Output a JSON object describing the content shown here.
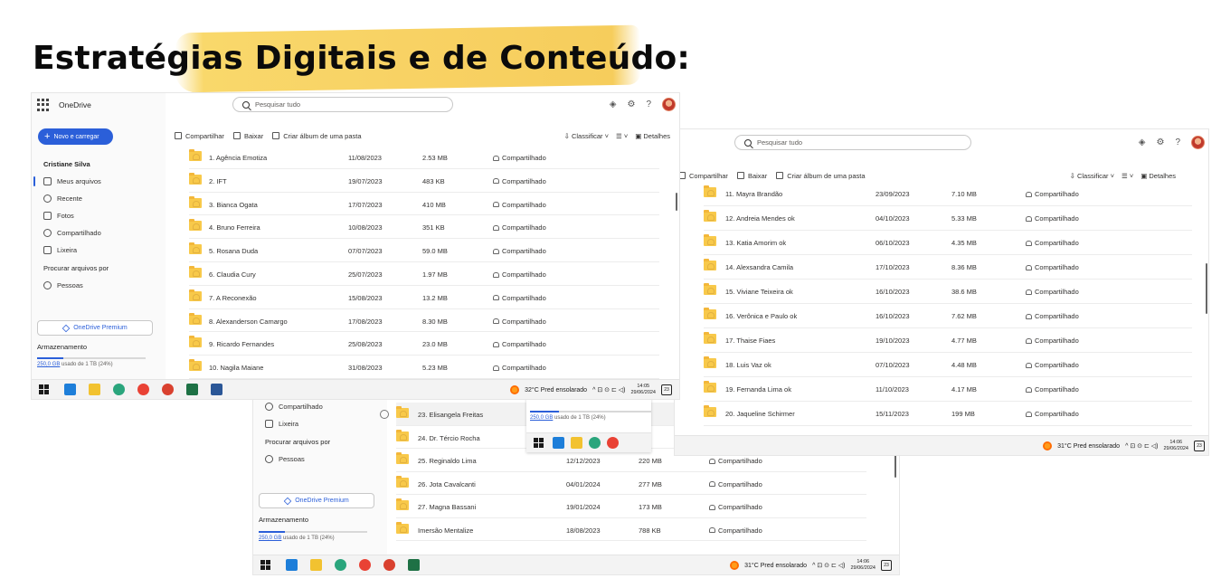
{
  "title": "Estratégias Digitais e de Conteúdo:",
  "app": {
    "brand": "OneDrive",
    "search_placeholder": "Pesquisar tudo",
    "new_button": "Novo e carregar",
    "user": "Cristiane Silva",
    "nav_items": [
      "Meus arquivos",
      "Recente",
      "Fotos",
      "Compartilhado",
      "Lixeira"
    ],
    "nav_header": "Procurar arquivos por",
    "nav_people": "Pessoas",
    "premium": "OneDrive Premium",
    "storage_title": "Armazenamento",
    "storage_used_link": "250,0 GB",
    "storage_used_rest": "usado de 1 TB (24%)",
    "storage_fraction": 0.24,
    "cmd_share": "Compartilhar",
    "cmd_download": "Baixar",
    "cmd_album": "Criar álbum de uma pasta",
    "cmd_sort": "Classificar",
    "cmd_details": "Detalhes",
    "shared_label": "Compartilhado"
  },
  "window1": {
    "rows": [
      {
        "name": "1. Agência Emotiza",
        "date": "11/08/2023",
        "size": "2.53 MB"
      },
      {
        "name": "2. IFT",
        "date": "19/07/2023",
        "size": "483 KB"
      },
      {
        "name": "3. Bianca Ogata",
        "date": "17/07/2023",
        "size": "410 MB"
      },
      {
        "name": "4. Bruno Ferreira",
        "date": "10/08/2023",
        "size": "351 KB"
      },
      {
        "name": "5. Rosana Duda",
        "date": "07/07/2023",
        "size": "59.0 MB"
      },
      {
        "name": "6. Claudia Cury",
        "date": "25/07/2023",
        "size": "1.97 MB"
      },
      {
        "name": "7. A Reconexão",
        "date": "15/08/2023",
        "size": "13.2 MB"
      },
      {
        "name": "8. Alexanderson Camargo",
        "date": "17/08/2023",
        "size": "8.30 MB"
      },
      {
        "name": "9. Ricardo Fernandes",
        "date": "25/08/2023",
        "size": "23.0 MB"
      },
      {
        "name": "10. Nagila Maiane",
        "date": "31/08/2023",
        "size": "5.23 MB"
      }
    ],
    "weather": "32°C  Pred ensolarado",
    "time": "14:05",
    "date": "29/06/2024",
    "notif": "23"
  },
  "window2": {
    "rows": [
      {
        "name": "11. Mayra Brandão",
        "date": "23/09/2023",
        "size": "7.10 MB"
      },
      {
        "name": "12. Andreia Mendes ok",
        "date": "04/10/2023",
        "size": "5.33 MB"
      },
      {
        "name": "13. Katia Amorim ok",
        "date": "06/10/2023",
        "size": "4.35 MB"
      },
      {
        "name": "14. Alexsandra Camila",
        "date": "17/10/2023",
        "size": "8.36 MB"
      },
      {
        "name": "15. Viviane Teixeira ok",
        "date": "16/10/2023",
        "size": "38.6 MB"
      },
      {
        "name": "16. Verônica e Paulo ok",
        "date": "16/10/2023",
        "size": "7.62 MB"
      },
      {
        "name": "17. Thaise Fiaes",
        "date": "19/10/2023",
        "size": "4.77 MB"
      },
      {
        "name": "18. Luis Vaz ok",
        "date": "07/10/2023",
        "size": "4.48 MB"
      },
      {
        "name": "19. Fernanda Lima ok",
        "date": "11/10/2023",
        "size": "4.17 MB"
      },
      {
        "name": "20. Jaqueline Schirmer",
        "date": "15/11/2023",
        "size": "199 MB"
      }
    ],
    "weather": "31°C  Pred ensolarado",
    "time": "14:06",
    "date": "29/06/2024",
    "notif": "23"
  },
  "window3": {
    "rows": [
      {
        "name": "23. Elisangela Freitas",
        "date": "",
        "size": ""
      },
      {
        "name": "24. Dr. Tércio Rocha",
        "date": "",
        "size": ""
      },
      {
        "name": "25. Reginaldo Lima",
        "date": "12/12/2023",
        "size": "220 MB"
      },
      {
        "name": "26. Jota Cavalcanti",
        "date": "04/01/2024",
        "size": "277 MB"
      },
      {
        "name": "27. Magna Bassani",
        "date": "19/01/2024",
        "size": "173 MB"
      },
      {
        "name": "Imersão Mentalize",
        "date": "18/08/2023",
        "size": "788 KB"
      }
    ],
    "weather": "31°C  Pred ensolarado",
    "time": "14:06",
    "date": "29/06/2024",
    "notif": "23",
    "overlay_storage_title": "Armazenamento",
    "overlay_storage_link": "250,0 GB",
    "overlay_storage_rest": "usado de 1 TB (24%)"
  },
  "colors": {
    "accent": "#2b5fd9",
    "highlight": "#f8d264",
    "folder": "#f8c94a"
  }
}
